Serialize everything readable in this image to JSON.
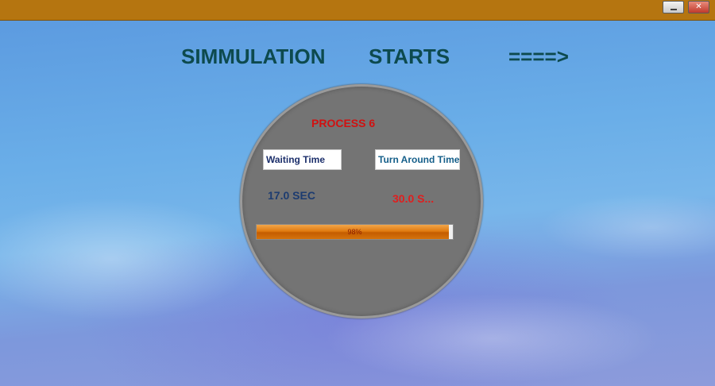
{
  "window": {
    "minimize_icon": "minimize-icon",
    "close_glyph": "✕",
    "titlebar_color": "#b57510"
  },
  "heading": {
    "word_1": "SIMMULATION",
    "word_2": "STARTS",
    "arrow": "====>"
  },
  "panel": {
    "process_label": "PROCESS 6",
    "waiting_time_label": "Waiting Time",
    "turn_around_time_label": "Turn Around Time",
    "waiting_time_value": "17.0 SEC",
    "turn_around_time_value": "30.0 S...",
    "progress": {
      "value": 98,
      "text": "98%"
    }
  },
  "colors": {
    "process_label": "#d11111",
    "turn_around_value": "#e01e1e",
    "progress_fill": "#e07b10"
  }
}
